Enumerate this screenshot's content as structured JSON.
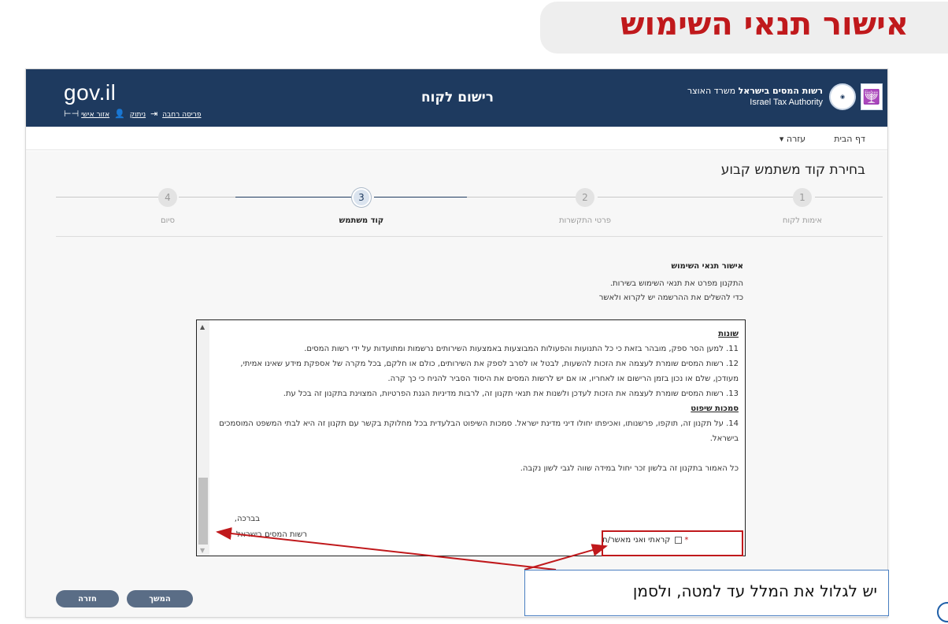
{
  "page_title": "אישור תנאי השימוש",
  "header": {
    "logo": "gov.il",
    "links": [
      "אזור אישי",
      "ניתוק",
      "פריסה רחבה"
    ],
    "center_title": "רישום לקוח",
    "authority_he_bold": "רשות המסים בישראל",
    "authority_he_rest": "משרד האוצר",
    "authority_en": "Israel Tax Authority",
    "colors": {
      "header_bg": "#1e3a5f",
      "accent_red": "#c0191c"
    }
  },
  "nav": {
    "home": "דף הבית",
    "help": "עזרה ▾"
  },
  "section_title": "בחירת קוד משתמש קבוע",
  "stepper": {
    "current": 3,
    "steps": [
      {
        "num": "1",
        "label": "אימות לקוח"
      },
      {
        "num": "2",
        "label": "פרטי התקשרות"
      },
      {
        "num": "3",
        "label": "קוד משתמש"
      },
      {
        "num": "4",
        "label": "סיום"
      }
    ]
  },
  "terms": {
    "heading": "אישור תנאי השימוש",
    "intro_1": "התקנון מפרט את תנאי השימוש בשירות.",
    "intro_2": "כדי להשלים את ההרשמה יש לקרוא ולאשר",
    "sec_misc": "שונות",
    "p11": "11. למען הסר ספק, מובהר בזאת כי כל התנועות והפעולות המבוצעות באמצעות השירותים נרשמות ומתועדות על ידי רשות המסים.",
    "p12": "12. רשות המסים שומרת לעצמה את הזכות להשעות, לבטל או לסרב לספק את השירותים, כולם או חלקם, בכל מקרה של אספקת מידע שאינו אמיתי, מעודכן, שלם או נכון בזמן הרישום או לאחריו, או אם יש לרשות המסים את היסוד הסביר להניח כי כך קרה.",
    "p13": "13. רשות המסים שומרת לעצמה את הזכות לעדכן ולשנות את תנאי תקנון זה, לרבות מדיניות הגנת הפרטיות, המצוינת בתקנון זה בכל עת.",
    "sec_jurisdiction": "סמכות שיפוט",
    "p14": "14. על תקנון זה, תוקפו, פרשנותו, ואכיפתו יחולו דיני מדינת ישראל. סמכות השיפוט הבלעדית בכל מחלוקת בקשר עם תקנון זה היא לבתי המשפט המוסמכים בישראל.",
    "gender_note": "כל האמור בתקנון זה בלשון זכר יחול במידה שווה לגבי לשון נקבה.",
    "sign_1": "בברכה,",
    "sign_2": "רשות המסים בישראל"
  },
  "confirm": {
    "required_mark": "*",
    "label": "קראתי ואני מאשר/ת",
    "checked": false
  },
  "buttons": {
    "continue": "המשך",
    "back": "חזרה"
  },
  "annotation": {
    "callout": "יש לגלול את המלל עד למטה, ולסמן"
  }
}
